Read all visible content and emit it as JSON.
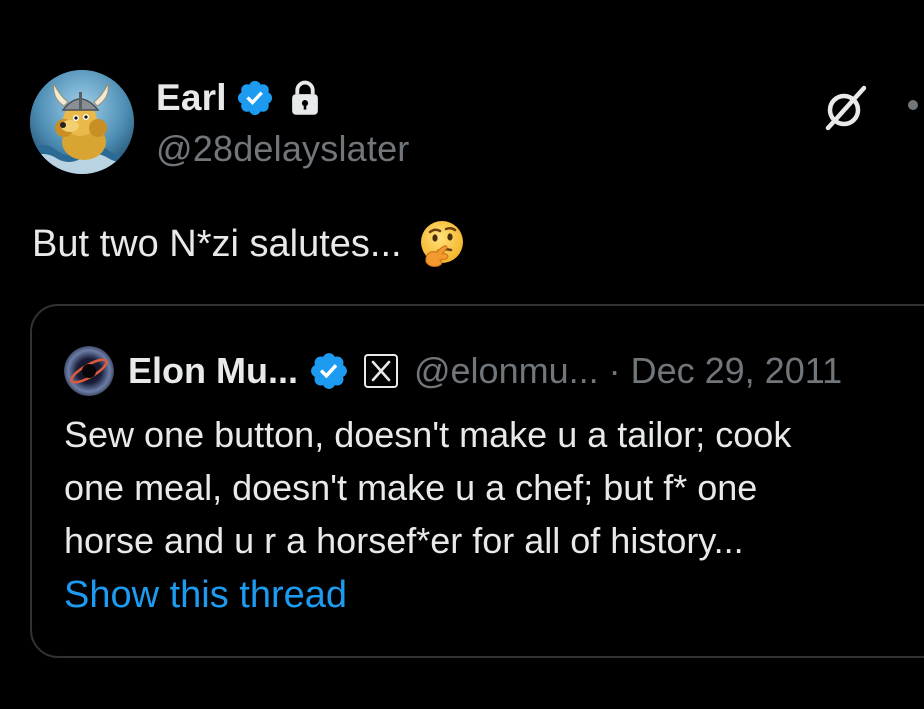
{
  "post": {
    "author": {
      "display_name": "Earl",
      "handle": "@28delayslater",
      "verified": true,
      "protected": true,
      "avatar_icon": "viking-poodle-avatar"
    },
    "text": "But two N*zi salutes...",
    "emoji_icon": "thinking-face-emoji",
    "header_action_icon": "grok-icon"
  },
  "quote": {
    "author": {
      "display_name": "Elon Mu...",
      "handle": "@elonmu...",
      "verified": true,
      "badge_icon": "x-logo-icon",
      "avatar_icon": "black-hole-avatar"
    },
    "separator": "·",
    "date": "Dec 29, 2011",
    "lines": [
      "Sew one button, doesn't make u a tailor; cook",
      "one meal, doesn't make u a chef; but f* one",
      "horse and u r a horsef*er for all of history..."
    ],
    "show_thread_label": "Show this thread"
  },
  "colors": {
    "background": "#000000",
    "text_primary": "#e7e9ea",
    "text_secondary": "#71767b",
    "accent_blue": "#1d9bf0",
    "border": "#2f3336"
  }
}
